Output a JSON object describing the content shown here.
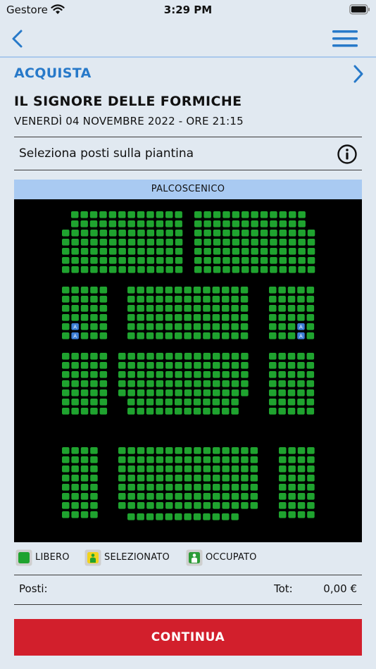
{
  "status_bar": {
    "carrier": "Gestore",
    "time": "3:29 PM"
  },
  "nav": {
    "back_icon": "chevron-left-icon",
    "menu_icon": "hamburger-menu-icon"
  },
  "section": {
    "label": "ACQUISTA"
  },
  "event": {
    "title": "IL SIGNORE DELLE FORMICHE",
    "datetime": "VENERDÌ 04 NOVEMBRE 2022 - ORE 21:15"
  },
  "select_seats": {
    "label": "Seleziona posti sulla piantina",
    "icon": "info-icon"
  },
  "seat_map": {
    "stage_label": "PALCOSCENICO",
    "colors": {
      "free": "#1fa32f",
      "accessible": "#3d7fd6",
      "background": "#000000"
    },
    "accessible_seat_letter": "A"
  },
  "legend": {
    "free": "LIBERO",
    "selected": "SELEZIONATO",
    "occupied": "OCCUPATO"
  },
  "summary": {
    "seats_label": "Posti:",
    "total_label": "Tot:",
    "total_value": "0,00 €"
  },
  "cta": {
    "label": "CONTINUA"
  },
  "colors": {
    "accent": "#2779c9",
    "cta": "#d21f2c",
    "background": "#e1e9f1",
    "stage": "#a9caf2"
  }
}
